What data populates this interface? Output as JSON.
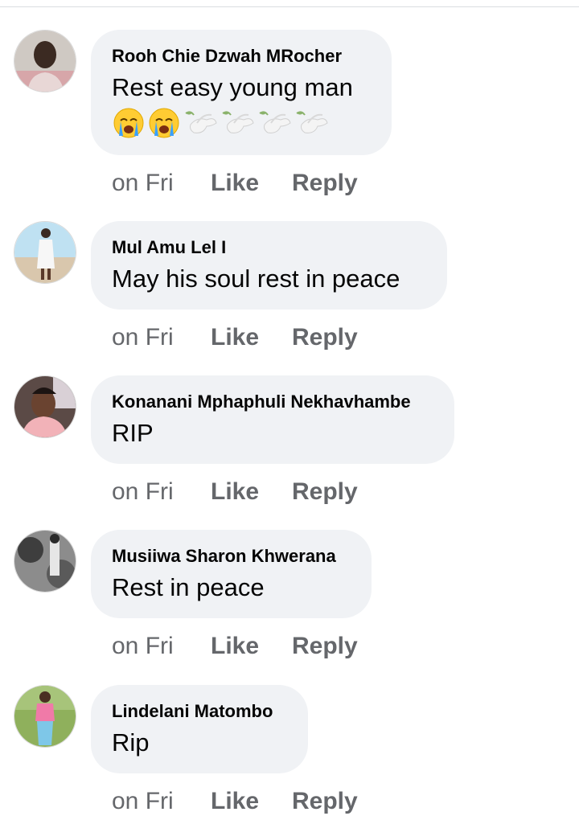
{
  "comments": [
    {
      "author": "Rooh Chie Dzwah MRocher",
      "text": "Rest easy young man",
      "emojis": [
        "loudly-crying-face",
        "loudly-crying-face",
        "dove",
        "dove",
        "dove",
        "dove"
      ],
      "time": "on Fri",
      "like_label": "Like",
      "reply_label": "Reply"
    },
    {
      "author": "Mul Amu Lel I",
      "text": "May his soul rest in peace",
      "time": "on Fri",
      "like_label": "Like",
      "reply_label": "Reply"
    },
    {
      "author": "Konanani Mphaphuli Nekhavhambe",
      "text": "RIP",
      "time": "on Fri",
      "like_label": "Like",
      "reply_label": "Reply"
    },
    {
      "author": "Musiiwa Sharon Khwerana",
      "text": "Rest in peace",
      "time": "on Fri",
      "like_label": "Like",
      "reply_label": "Reply"
    },
    {
      "author": "Lindelani Matombo",
      "text": "Rip",
      "time": "on Fri",
      "like_label": "Like",
      "reply_label": "Reply"
    }
  ],
  "colors": {
    "bubble_background": "#f0f2f5",
    "author_text": "#050505",
    "action_text": "#65676b"
  }
}
